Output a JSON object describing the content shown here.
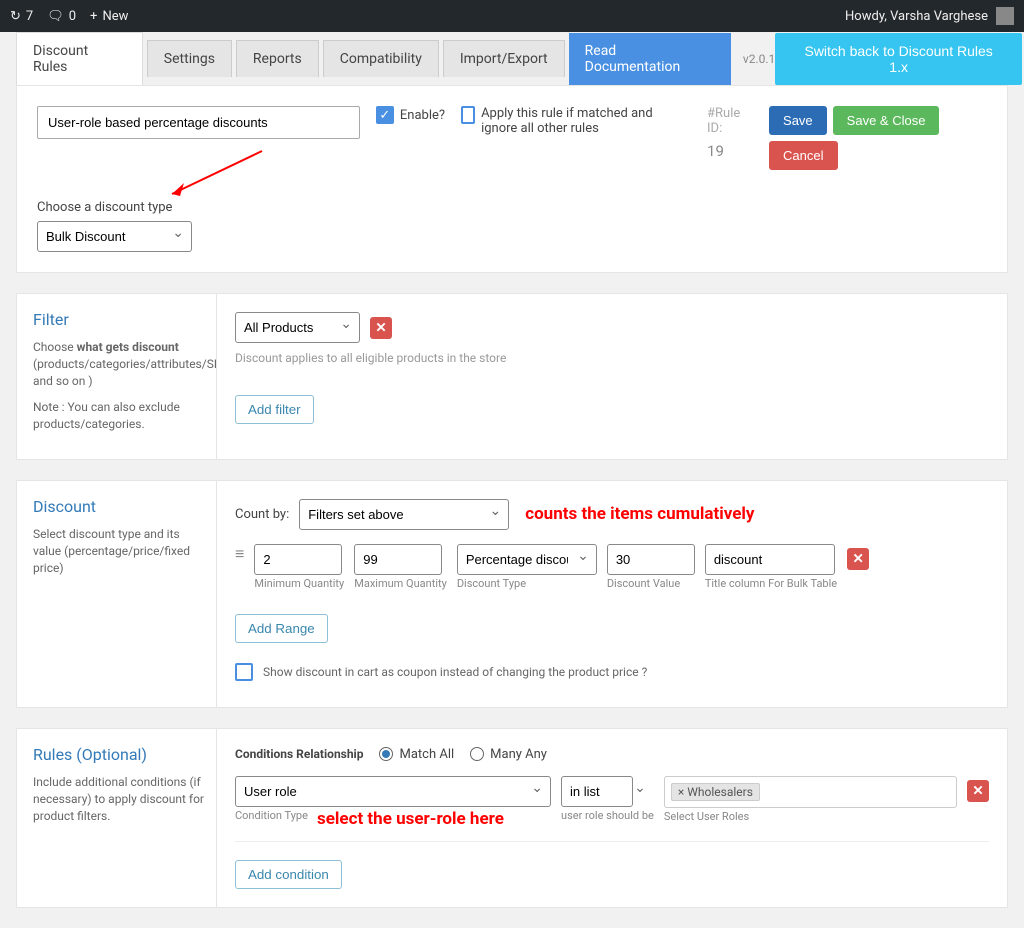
{
  "adminbar": {
    "count1": "7",
    "count2": "0",
    "new_label": "New",
    "howdy": "Howdy, Varsha Varghese"
  },
  "tabs": {
    "rules": "Discount Rules",
    "settings": "Settings",
    "reports": "Reports",
    "compat": "Compatibility",
    "import": "Import/Export",
    "doc": "Read Documentation",
    "version": "v2.0.1",
    "switch": "Switch back to Discount Rules 1.x"
  },
  "top": {
    "rule_name": "User-role based percentage discounts",
    "enable": "Enable?",
    "apply_text": "Apply this rule if matched and ignore all other rules",
    "rule_id_label": "#Rule ID:",
    "rule_id_value": "19",
    "save": "Save",
    "save_close": "Save & Close",
    "cancel": "Cancel",
    "discount_type_label": "Choose a discount type",
    "discount_type_value": "Bulk Discount"
  },
  "filter": {
    "title": "Filter",
    "desc1a": "Choose ",
    "desc1b": "what gets discount",
    "desc1c": " (products/categories/attributes/SKU and so on )",
    "desc2": "Note : You can also exclude products/categories.",
    "select": "All Products",
    "help": "Discount applies to all eligible products in the store",
    "add": "Add filter"
  },
  "discount": {
    "title": "Discount",
    "desc": "Select discount type and its value (percentage/price/fixed price)",
    "count_by_label": "Count by:",
    "count_by_value": "Filters set above",
    "annotation": "counts the items cumulatively",
    "min_qty": "2",
    "min_qty_label": "Minimum Quantity",
    "max_qty": "99",
    "max_qty_label": "Maximum Quantity",
    "type_value": "Percentage discount",
    "type_label": "Discount Type",
    "value": "30",
    "value_label": "Discount Value",
    "title_col": "discount",
    "title_col_label": "Title column For Bulk Table",
    "add_range": "Add Range",
    "coupon_text": "Show discount in cart as coupon instead of changing the product price ?"
  },
  "rules": {
    "title": "Rules (Optional)",
    "desc": "Include additional conditions (if necessary) to apply discount for product filters.",
    "rel_label": "Conditions Relationship",
    "match_all": "Match All",
    "many_any": "Many Any",
    "cond_type_value": "User role",
    "cond_type_label": "Condition Type",
    "in_list": "in list",
    "role_help": "user role should be",
    "tag": "× Wholesalers",
    "select_roles": "Select User Roles",
    "annotation": "select the user-role here",
    "add": "Add condition"
  }
}
